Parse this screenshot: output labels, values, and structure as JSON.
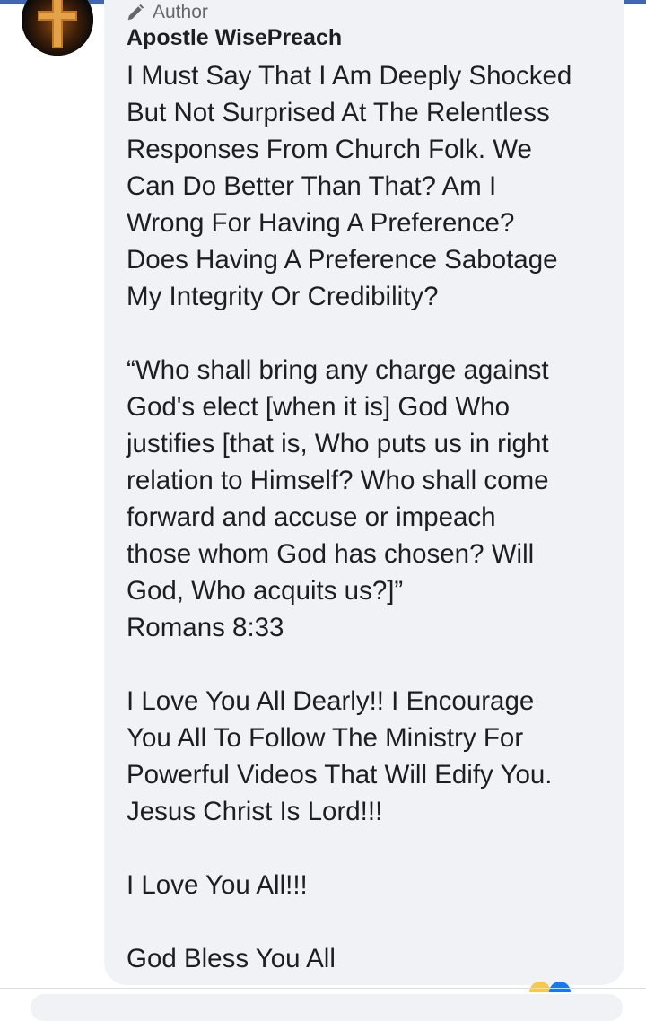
{
  "comment": {
    "badge_label": "Author",
    "author_name": "Apostle WisePreach",
    "paragraphs": [
      [
        "I Must Say That I Am Deeply Shocked",
        "But Not Surprised At The Relentless",
        "Responses From Church Folk. We",
        "Can Do Better Than That? Am I",
        "Wrong For Having A Preference?",
        "Does Having A Preference Sabotage",
        "My Integrity Or Credibility?"
      ],
      [
        "“Who shall bring any charge against",
        "God's elect [when it is] God Who",
        "justifies [that is, Who puts us in right",
        "relation to Himself? Who shall come",
        "forward and accuse or impeach",
        "those whom God has chosen? Will",
        "God, Who acquits us?]”",
        "Romans 8:33"
      ],
      [
        "I Love You All Dearly!! I Encourage",
        "You All To Follow The Ministry For",
        "Powerful Videos That Will Edify You.",
        "Jesus Christ Is Lord!!!"
      ],
      [
        "I Love You All!!!"
      ],
      [
        "God Bless You All"
      ]
    ]
  },
  "colors": {
    "bubble": "#f0f2f5",
    "text": "#1c1e21",
    "secondary_text": "#65676b",
    "accent": "#4267b2"
  },
  "icons": {
    "badge": "pencil-icon",
    "avatar": "cross-avatar"
  }
}
